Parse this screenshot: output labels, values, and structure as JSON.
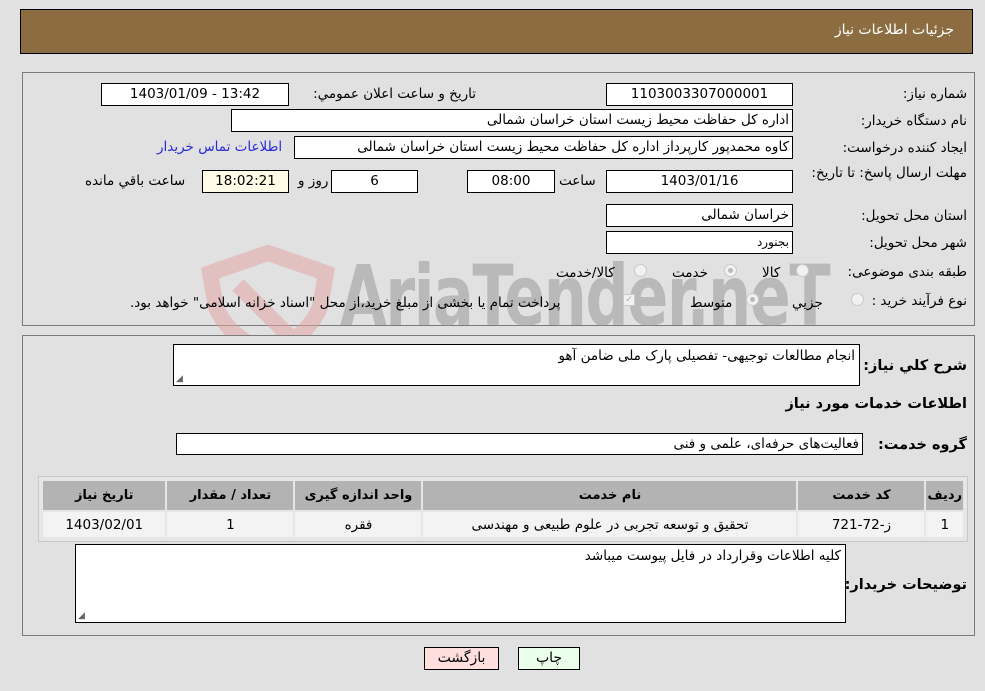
{
  "header": {
    "title": "جزئیات اطلاعات نیاز"
  },
  "form": {
    "need_number": {
      "label": "شماره نیاز:",
      "value": "1103003307000001"
    },
    "announce_datetime": {
      "label": "تاریخ و ساعت اعلان عمومي:",
      "value": "1403/01/09 - 13:42"
    },
    "buyer_org": {
      "label": "نام دستگاه خریدار:",
      "value": "اداره کل حفاظت محیط زیست استان خراسان شمالی"
    },
    "requester": {
      "label": "ایجاد کننده درخواست:",
      "value": "کاوه  محمدپور  کارپرداز اداره کل حفاظت محیط زیست استان خراسان شمالی"
    },
    "buyer_contact_link": "اطلاعات تماس خریدار",
    "deadline": {
      "label": "مهلت ارسال پاسخ: تا تاریخ:",
      "date": "1403/01/16",
      "time_label": "ساعت",
      "time": "08:00",
      "days": "6",
      "days_label": "روز و",
      "remaining": "18:02:21",
      "remaining_label": "ساعت باقي مانده"
    },
    "province": {
      "label": "استان محل تحویل:",
      "value": "خراسان شمالی"
    },
    "city": {
      "label": "شهر محل تحویل:",
      "value": "بجنورد"
    },
    "category": {
      "label": "طبقه بندی موضوعی:",
      "options": [
        "کالا",
        "خدمت",
        "کالا/خدمت"
      ],
      "selected": "خدمت"
    },
    "purchase_type": {
      "label": "نوع فرآیند خرید :",
      "options": [
        "جزیي",
        "متوسط"
      ],
      "selected": "متوسط",
      "treasury_note": "پرداخت تمام یا بخشی از مبلغ خرید،از محل \"اسناد خزانه اسلامی\" خواهد بود.",
      "treasury_checked": true
    }
  },
  "description": {
    "label": "شرح کلي نیاز:",
    "value": "انجام مطالعات توجیهی- تفصیلی پارک ملی ضامن آهو"
  },
  "services_section": {
    "title": "اطلاعات خدمات مورد نیاز",
    "group_label": "گروه خدمت:",
    "group_value": "فعالیت‌های حرفه‌ای، علمی و فنی",
    "table": {
      "headers": [
        "ردیف",
        "کد خدمت",
        "نام خدمت",
        "واحد اندازه گیری",
        "تعداد / مقدار",
        "تاریخ نیاز"
      ],
      "rows": [
        [
          "1",
          "ز-72-721",
          "تحقیق و توسعه تجربی در علوم طبیعی و مهندسی",
          "فقره",
          "1",
          "1403/02/01"
        ]
      ]
    }
  },
  "buyer_notes": {
    "label": "توضیحات خریدار:",
    "value": "کلیه اطلاعات وقرارداد در فایل پیوست میباشد"
  },
  "buttons": {
    "print": "چاپ",
    "back": "بازگشت"
  },
  "watermark": {
    "text": "AriaTender.neT"
  },
  "colors": {
    "header_bg": "#8c6d42",
    "link": "#2a2ad8",
    "back_btn": "#ffdede",
    "print_btn": "#eaffea"
  }
}
